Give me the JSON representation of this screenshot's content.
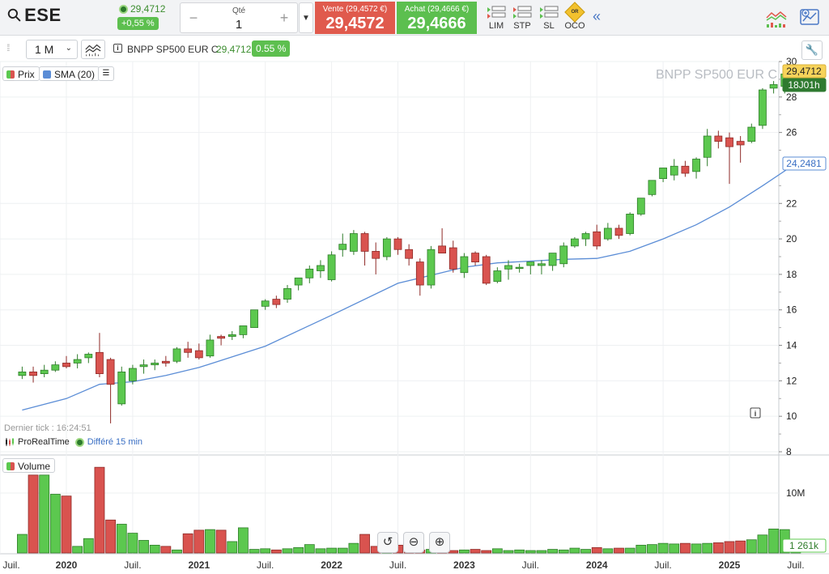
{
  "header": {
    "symbol": "ESE",
    "last_price": "29,4712",
    "last_change": "+0,55 %",
    "quantity_label": "Qté",
    "quantity_value": "1",
    "sell_label": "Vente (29,4572 €)",
    "sell_price": "29,4572",
    "buy_label": "Achat (29,4666 €)",
    "buy_price": "29,4666",
    "order_types": [
      "LIM",
      "STP",
      "SL",
      "OCO"
    ],
    "oco_badge": "OR"
  },
  "toolbar": {
    "period": "1 M",
    "instrument_name": "BNPP SP500 EUR C",
    "instrument_price": "29,4712",
    "instrument_change": "0.55 %"
  },
  "legend": {
    "price_label": "Prix",
    "sma_label": "SMA (20)",
    "volume_label": "Volume"
  },
  "watermark": "BNPP SP500 EUR C",
  "last_tick": "Dernier tick : 16:24:51",
  "source": {
    "name": "ProRealTime",
    "delay": "Différé 15 min"
  },
  "price_axis": {
    "ticks": [
      "30",
      "28",
      "26",
      "22",
      "20",
      "18",
      "16",
      "14",
      "12",
      "10",
      "8"
    ],
    "last_price_tag": "29,4712",
    "time_left_tag": "18J01h",
    "sma_tag": "24,2481"
  },
  "volume_axis": {
    "ticks": [
      "10M"
    ],
    "last_volume_tag": "1 261k"
  },
  "time_axis": [
    "Juil.",
    "2020",
    "Juil.",
    "2021",
    "Juil.",
    "2022",
    "Juil.",
    "2023",
    "Juil.",
    "2024",
    "Juil.",
    "2025",
    "Juil."
  ],
  "colors": {
    "up": "#5cc84f",
    "down": "#d9534f",
    "sma": "#5b8dd6",
    "accent_green": "#5dbf4f",
    "accent_red": "#e05a4d"
  },
  "chart_data": {
    "type": "candlestick",
    "timeframe": "1 M",
    "ylim": [
      8,
      30
    ],
    "candles": [
      {
        "date": "2019-09",
        "o": 12.3,
        "h": 12.8,
        "l": 12.1,
        "c": 12.5
      },
      {
        "date": "2019-10",
        "o": 12.5,
        "h": 12.8,
        "l": 11.9,
        "c": 12.3
      },
      {
        "date": "2019-11",
        "o": 12.4,
        "h": 12.9,
        "l": 12.2,
        "c": 12.6
      },
      {
        "date": "2019-12",
        "o": 12.6,
        "h": 13.1,
        "l": 12.5,
        "c": 12.9
      },
      {
        "date": "2020-01",
        "o": 13.0,
        "h": 13.4,
        "l": 12.7,
        "c": 12.8
      },
      {
        "date": "2020-02",
        "o": 13.0,
        "h": 13.5,
        "l": 12.7,
        "c": 13.2
      },
      {
        "date": "2020-03",
        "o": 13.3,
        "h": 13.6,
        "l": 13.0,
        "c": 13.5
      },
      {
        "date": "2020-04",
        "o": 13.6,
        "h": 14.7,
        "l": 12.2,
        "c": 12.4
      },
      {
        "date": "2020-05",
        "o": 13.2,
        "h": 13.3,
        "l": 9.6,
        "c": 11.8
      },
      {
        "date": "2020-06",
        "o": 10.7,
        "h": 12.8,
        "l": 10.6,
        "c": 12.5
      },
      {
        "date": "2020-07",
        "o": 12.0,
        "h": 12.9,
        "l": 11.8,
        "c": 12.7
      },
      {
        "date": "2020-08",
        "o": 12.8,
        "h": 13.2,
        "l": 12.4,
        "c": 12.9
      },
      {
        "date": "2020-09",
        "o": 12.9,
        "h": 13.2,
        "l": 12.6,
        "c": 13.0
      },
      {
        "date": "2020-10",
        "o": 13.1,
        "h": 13.4,
        "l": 12.8,
        "c": 13.0
      },
      {
        "date": "2020-11",
        "o": 13.1,
        "h": 13.9,
        "l": 13.0,
        "c": 13.8
      },
      {
        "date": "2020-12",
        "o": 13.8,
        "h": 14.2,
        "l": 13.3,
        "c": 13.6
      },
      {
        "date": "2021-01",
        "o": 13.7,
        "h": 14.1,
        "l": 13.2,
        "c": 13.3
      },
      {
        "date": "2021-02",
        "o": 13.4,
        "h": 14.6,
        "l": 13.3,
        "c": 14.3
      },
      {
        "date": "2021-03",
        "o": 14.5,
        "h": 14.6,
        "l": 14.0,
        "c": 14.4
      },
      {
        "date": "2021-04",
        "o": 14.5,
        "h": 14.8,
        "l": 14.3,
        "c": 14.6
      },
      {
        "date": "2021-05",
        "o": 14.6,
        "h": 15.1,
        "l": 14.4,
        "c": 15.1
      },
      {
        "date": "2021-06",
        "o": 15.0,
        "h": 16.0,
        "l": 15.0,
        "c": 16.0
      },
      {
        "date": "2021-07",
        "o": 16.2,
        "h": 16.6,
        "l": 16.0,
        "c": 16.5
      },
      {
        "date": "2021-08",
        "o": 16.6,
        "h": 16.8,
        "l": 16.1,
        "c": 16.3
      },
      {
        "date": "2021-09",
        "o": 16.6,
        "h": 17.4,
        "l": 16.4,
        "c": 17.2
      },
      {
        "date": "2021-10",
        "o": 17.4,
        "h": 17.8,
        "l": 17.1,
        "c": 17.8
      },
      {
        "date": "2021-11",
        "o": 17.8,
        "h": 18.5,
        "l": 17.5,
        "c": 18.3
      },
      {
        "date": "2021-12",
        "o": 18.2,
        "h": 18.8,
        "l": 17.8,
        "c": 18.5
      },
      {
        "date": "2022-01",
        "o": 17.7,
        "h": 19.3,
        "l": 17.6,
        "c": 19.1
      },
      {
        "date": "2022-02",
        "o": 19.4,
        "h": 20.3,
        "l": 19.0,
        "c": 19.7
      },
      {
        "date": "2022-03",
        "o": 19.3,
        "h": 20.5,
        "l": 19.1,
        "c": 20.3
      },
      {
        "date": "2022-04",
        "o": 20.3,
        "h": 20.4,
        "l": 18.5,
        "c": 19.3
      },
      {
        "date": "2022-05",
        "o": 19.3,
        "h": 19.8,
        "l": 18.0,
        "c": 18.9
      },
      {
        "date": "2022-06",
        "o": 19.0,
        "h": 20.1,
        "l": 18.8,
        "c": 20.0
      },
      {
        "date": "2022-07",
        "o": 20.0,
        "h": 20.1,
        "l": 19.1,
        "c": 19.4
      },
      {
        "date": "2022-08",
        "o": 19.4,
        "h": 19.7,
        "l": 18.5,
        "c": 18.9
      },
      {
        "date": "2022-09",
        "o": 18.7,
        "h": 18.9,
        "l": 16.8,
        "c": 17.4
      },
      {
        "date": "2022-10",
        "o": 17.4,
        "h": 19.6,
        "l": 17.2,
        "c": 19.4
      },
      {
        "date": "2022-11",
        "o": 19.6,
        "h": 20.6,
        "l": 19.2,
        "c": 19.2
      },
      {
        "date": "2022-12",
        "o": 19.5,
        "h": 19.9,
        "l": 18.1,
        "c": 18.3
      },
      {
        "date": "2023-01",
        "o": 18.1,
        "h": 19.2,
        "l": 17.8,
        "c": 19.0
      },
      {
        "date": "2023-02",
        "o": 19.2,
        "h": 19.3,
        "l": 18.5,
        "c": 18.7
      },
      {
        "date": "2023-03",
        "o": 19.0,
        "h": 19.1,
        "l": 17.4,
        "c": 17.5
      },
      {
        "date": "2023-04",
        "o": 17.6,
        "h": 18.4,
        "l": 17.5,
        "c": 18.2
      },
      {
        "date": "2023-05",
        "o": 18.3,
        "h": 18.8,
        "l": 17.7,
        "c": 18.5
      },
      {
        "date": "2023-06",
        "o": 18.4,
        "h": 18.6,
        "l": 18.1,
        "c": 18.4
      },
      {
        "date": "2023-07",
        "o": 18.5,
        "h": 18.7,
        "l": 18.0,
        "c": 18.7
      },
      {
        "date": "2023-08",
        "o": 18.5,
        "h": 18.8,
        "l": 18.0,
        "c": 18.6
      },
      {
        "date": "2023-09",
        "o": 18.5,
        "h": 18.9,
        "l": 18.2,
        "c": 19.2
      },
      {
        "date": "2023-10",
        "o": 18.6,
        "h": 19.8,
        "l": 18.4,
        "c": 19.6
      },
      {
        "date": "2023-11",
        "o": 19.6,
        "h": 20.1,
        "l": 19.5,
        "c": 20.0
      },
      {
        "date": "2023-12",
        "o": 20.0,
        "h": 20.4,
        "l": 19.6,
        "c": 20.3
      },
      {
        "date": "2024-01",
        "o": 20.4,
        "h": 20.8,
        "l": 19.4,
        "c": 19.6
      },
      {
        "date": "2024-02",
        "o": 20.0,
        "h": 20.9,
        "l": 19.9,
        "c": 20.6
      },
      {
        "date": "2024-03",
        "o": 20.6,
        "h": 20.8,
        "l": 20.0,
        "c": 20.2
      },
      {
        "date": "2024-04",
        "o": 20.3,
        "h": 21.5,
        "l": 20.2,
        "c": 21.4
      },
      {
        "date": "2024-05",
        "o": 21.4,
        "h": 22.3,
        "l": 21.3,
        "c": 22.3
      },
      {
        "date": "2024-06",
        "o": 22.5,
        "h": 23.3,
        "l": 22.4,
        "c": 23.3
      },
      {
        "date": "2024-07",
        "o": 23.4,
        "h": 24.0,
        "l": 23.2,
        "c": 24.0
      },
      {
        "date": "2024-08",
        "o": 23.6,
        "h": 24.5,
        "l": 23.3,
        "c": 24.1
      },
      {
        "date": "2024-09",
        "o": 24.1,
        "h": 24.4,
        "l": 23.5,
        "c": 23.7
      },
      {
        "date": "2024-10",
        "o": 23.8,
        "h": 24.6,
        "l": 23.4,
        "c": 24.5
      },
      {
        "date": "2024-11",
        "o": 24.6,
        "h": 26.2,
        "l": 24.1,
        "c": 25.8
      },
      {
        "date": "2024-12",
        "o": 25.8,
        "h": 26.1,
        "l": 25.1,
        "c": 25.5
      },
      {
        "date": "2025-01",
        "o": 25.7,
        "h": 26.0,
        "l": 23.1,
        "c": 25.2
      },
      {
        "date": "2025-02",
        "o": 25.5,
        "h": 25.8,
        "l": 24.3,
        "c": 25.3
      },
      {
        "date": "2025-03",
        "o": 25.5,
        "h": 26.5,
        "l": 25.4,
        "c": 26.3
      },
      {
        "date": "2025-04",
        "o": 26.4,
        "h": 28.5,
        "l": 26.2,
        "c": 28.4
      },
      {
        "date": "2025-05",
        "o": 28.5,
        "h": 28.9,
        "l": 28.2,
        "c": 28.7
      },
      {
        "date": "2025-06",
        "o": 28.6,
        "h": 29.5,
        "l": 28.2,
        "c": 29.3
      },
      {
        "date": "2025-07",
        "o": 29.3,
        "h": 29.8,
        "l": 29.0,
        "c": 29.47
      }
    ],
    "sma": [
      {
        "date": "2019-09",
        "v": 10.35
      },
      {
        "date": "2020-01",
        "v": 11.0
      },
      {
        "date": "2020-04",
        "v": 11.8
      },
      {
        "date": "2020-07",
        "v": 11.95
      },
      {
        "date": "2020-10",
        "v": 12.3
      },
      {
        "date": "2021-01",
        "v": 12.75
      },
      {
        "date": "2021-07",
        "v": 13.95
      },
      {
        "date": "2022-01",
        "v": 15.7
      },
      {
        "date": "2022-07",
        "v": 17.5
      },
      {
        "date": "2022-10",
        "v": 17.95
      },
      {
        "date": "2023-01",
        "v": 18.4
      },
      {
        "date": "2023-04",
        "v": 18.65
      },
      {
        "date": "2023-07",
        "v": 18.75
      },
      {
        "date": "2023-10",
        "v": 18.85
      },
      {
        "date": "2024-01",
        "v": 18.9
      },
      {
        "date": "2024-04",
        "v": 19.3
      },
      {
        "date": "2024-07",
        "v": 20.0
      },
      {
        "date": "2024-10",
        "v": 20.8
      },
      {
        "date": "2025-01",
        "v": 21.8
      },
      {
        "date": "2025-04",
        "v": 23.0
      },
      {
        "date": "2025-07",
        "v": 24.25
      }
    ],
    "volume": [
      3.1,
      13.0,
      13.0,
      9.8,
      9.5,
      1.1,
      2.4,
      14.3,
      5.5,
      4.8,
      3.3,
      2.1,
      1.3,
      1.1,
      0.5,
      3.2,
      3.8,
      3.9,
      3.8,
      1.9,
      4.2,
      0.6,
      0.7,
      0.5,
      0.7,
      0.9,
      1.4,
      0.7,
      0.8,
      0.8,
      1.6,
      3.1,
      1.1,
      2.5,
      1.3,
      0.6,
      0.5,
      0.6,
      0.5,
      0.4,
      0.5,
      0.6,
      0.4,
      0.7,
      0.4,
      0.5,
      0.4,
      0.4,
      0.6,
      0.5,
      0.8,
      0.6,
      0.9,
      0.7,
      0.8,
      0.8,
      1.3,
      1.4,
      1.6,
      1.5,
      1.6,
      1.5,
      1.6,
      1.7,
      1.9,
      2.0,
      2.2,
      3.0,
      4.0,
      3.9,
      1.26
    ],
    "volume_unit": "M"
  }
}
